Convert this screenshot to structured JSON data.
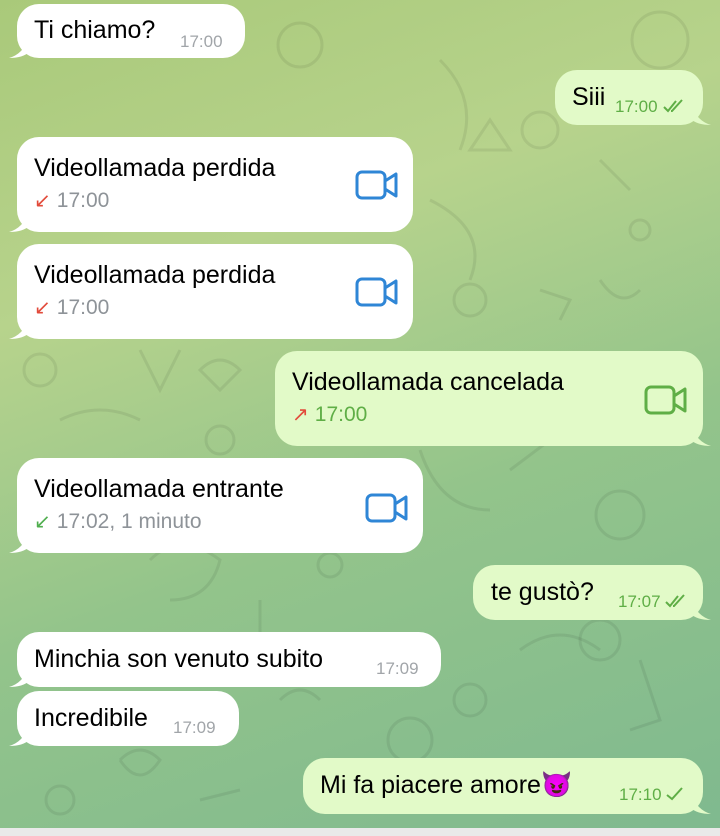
{
  "messages": [
    {
      "kind": "text",
      "dir": "in",
      "text": "Ti chiamo?",
      "time": "17:00"
    },
    {
      "kind": "text",
      "dir": "out",
      "text": "Siii",
      "time": "17:00",
      "read": true
    },
    {
      "kind": "call",
      "dir": "in",
      "title": "Videollamada perdida",
      "meta": "17:00",
      "arrow": "↙",
      "arrow_color": "#e24b3b"
    },
    {
      "kind": "call",
      "dir": "in",
      "title": "Videollamada perdida",
      "meta": "17:00",
      "arrow": "↙",
      "arrow_color": "#e24b3b"
    },
    {
      "kind": "call",
      "dir": "out",
      "title": "Videollamada cancelada",
      "meta": "17:00",
      "arrow": "↗",
      "arrow_color": "#e24b3b"
    },
    {
      "kind": "call",
      "dir": "in",
      "title": "Videollamada entrante",
      "meta": "17:02, 1 minuto",
      "arrow": "↙",
      "arrow_color": "#4fae4e"
    },
    {
      "kind": "text",
      "dir": "out",
      "text": "te gustò?",
      "time": "17:07",
      "read": true
    },
    {
      "kind": "text",
      "dir": "in",
      "text": "Minchia son venuto subito",
      "time": "17:09"
    },
    {
      "kind": "text",
      "dir": "in",
      "text": "Incredibile",
      "time": "17:09"
    },
    {
      "kind": "text",
      "dir": "out",
      "text": "Mi fa piacere amore",
      "emoji": "😈",
      "time": "17:10",
      "read": false
    }
  ],
  "icons": {
    "video_call": "video-camera-icon",
    "read_receipt": "double-check-icon",
    "sent_receipt": "single-check-icon"
  },
  "colors": {
    "incoming_bubble": "#ffffff",
    "outgoing_bubble": "#e2fac8",
    "accent_blue": "#2f86d6",
    "outgoing_time": "#5fae46",
    "missed_red": "#e24b3b",
    "incoming_green": "#4fae4e"
  }
}
